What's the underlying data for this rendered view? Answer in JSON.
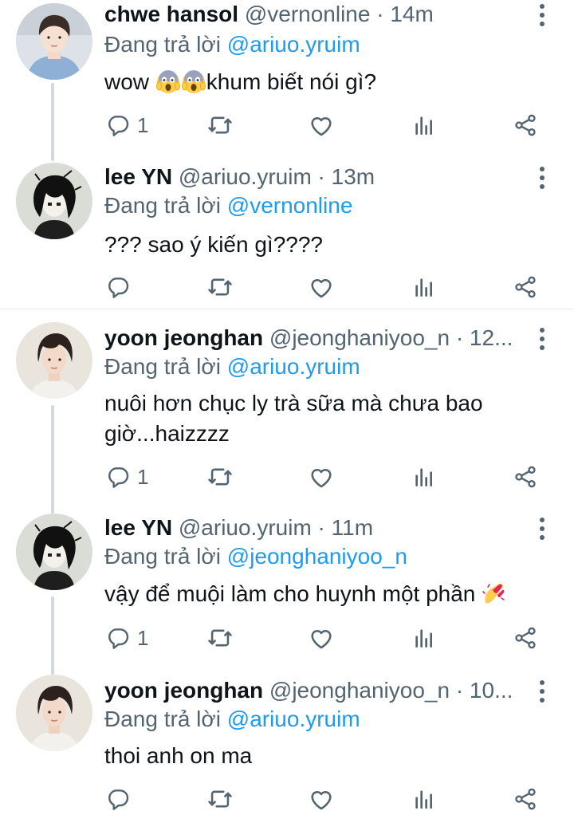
{
  "tweets": [
    {
      "name": "chwe hansol",
      "meta": "@vernonline · 14m",
      "reply_prefix": "Đang trả lời ",
      "reply_to": "@ariuo.yruim",
      "text_before_emoji": "wow ",
      "text_after_emoji": "khum biết nói gì?",
      "emoji_name": "face-screaming-in-fear",
      "reply_count": "1"
    },
    {
      "name": "lee YN",
      "meta": "@ariuo.yruim · 13m",
      "reply_prefix": "Đang trả lời ",
      "reply_to": "@vernonline",
      "text": "??? sao ý kiến gì????",
      "reply_count": ""
    },
    {
      "name": "yoon jeonghan",
      "meta": "@jeonghaniyoo_n · 12...",
      "reply_prefix": "Đang trả lời ",
      "reply_to": "@ariuo.yruim",
      "text_line1": "nuôi hơn chục ly trà sữa mà chưa bao",
      "text_line2": "giờ...haizzzz",
      "reply_count": "1"
    },
    {
      "name": "lee YN",
      "meta": "@ariuo.yruim · 11m",
      "reply_prefix": "Đang trả lời ",
      "reply_to": "@jeonghaniyoo_n",
      "text": "vậy để muội làm cho huynh một phần ",
      "emoji_name": "nail-polish",
      "reply_count": "1"
    },
    {
      "name": "yoon jeonghan",
      "meta": "@jeonghaniyoo_n · 10...",
      "reply_prefix": "Đang trả lời ",
      "reply_to": "@ariuo.yruim",
      "text": "thoi anh on ma",
      "reply_count": ""
    }
  ],
  "icons": {
    "reply": "reply-icon",
    "retweet": "retweet-icon",
    "like": "like-icon",
    "views": "views-icon",
    "share": "share-icon",
    "more": "more-vertical-icon"
  },
  "colors": {
    "text": "#0f1419",
    "muted": "#536471",
    "mention": "#1d9bf0",
    "thread_line": "#cfd9de"
  }
}
